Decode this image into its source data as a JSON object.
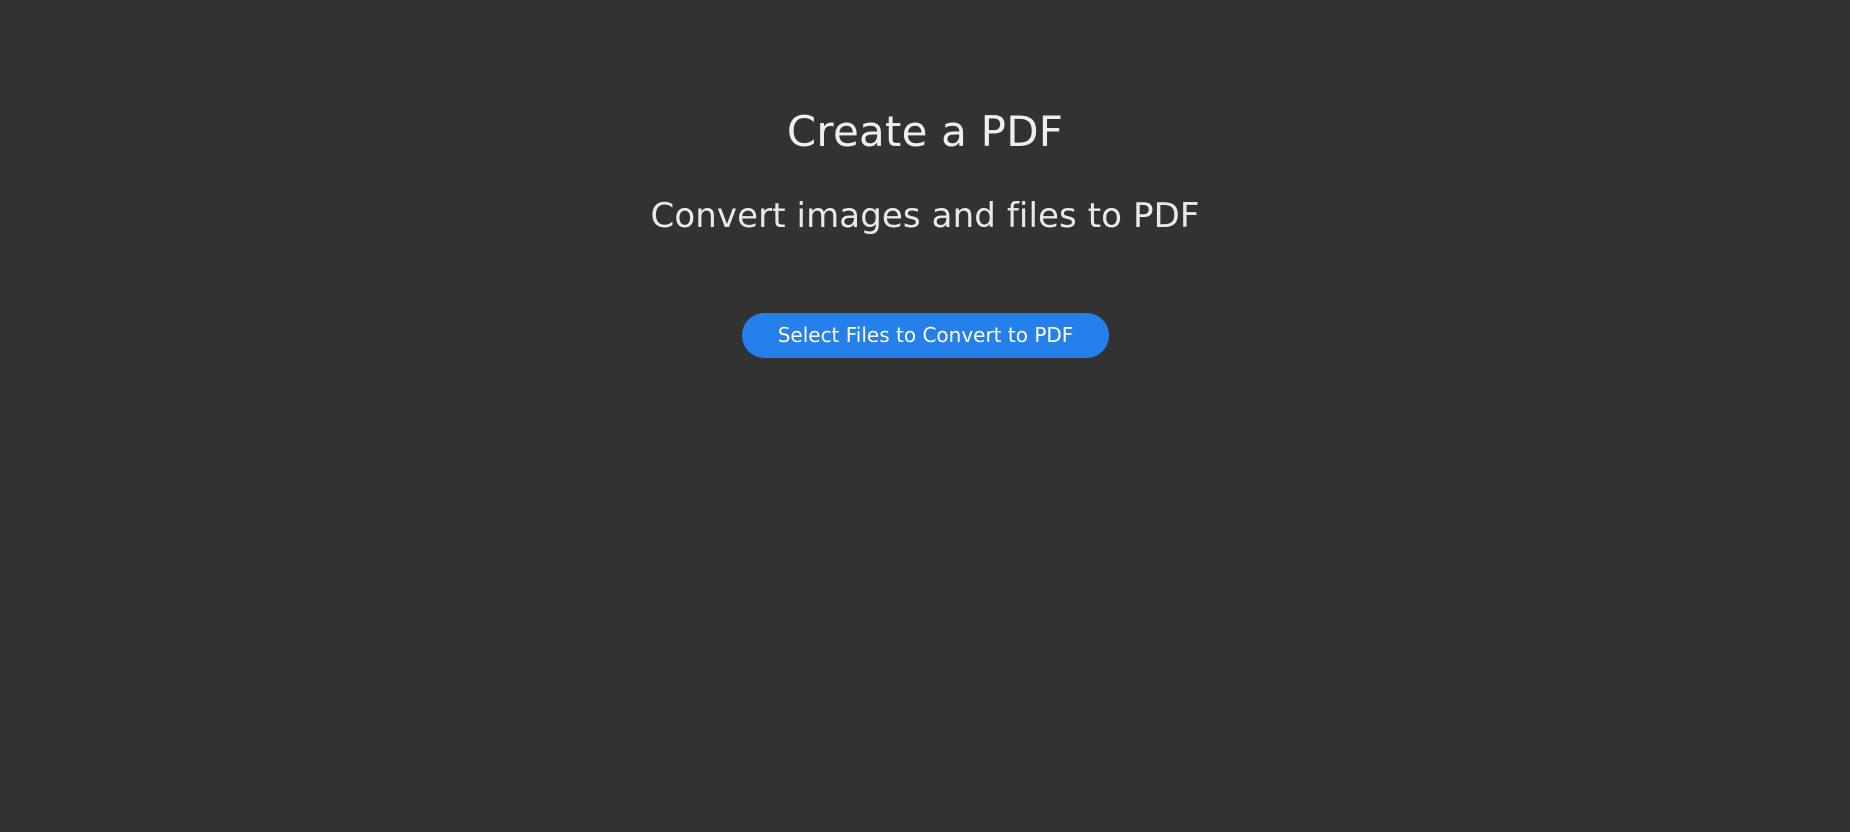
{
  "page": {
    "title": "Create a PDF",
    "subtitle": "Convert images and files to PDF"
  },
  "actions": {
    "select_files_label": "Select Files to Convert to PDF"
  },
  "colors": {
    "background": "#323232",
    "primary_button": "#2680eb",
    "text": "#ececec"
  }
}
